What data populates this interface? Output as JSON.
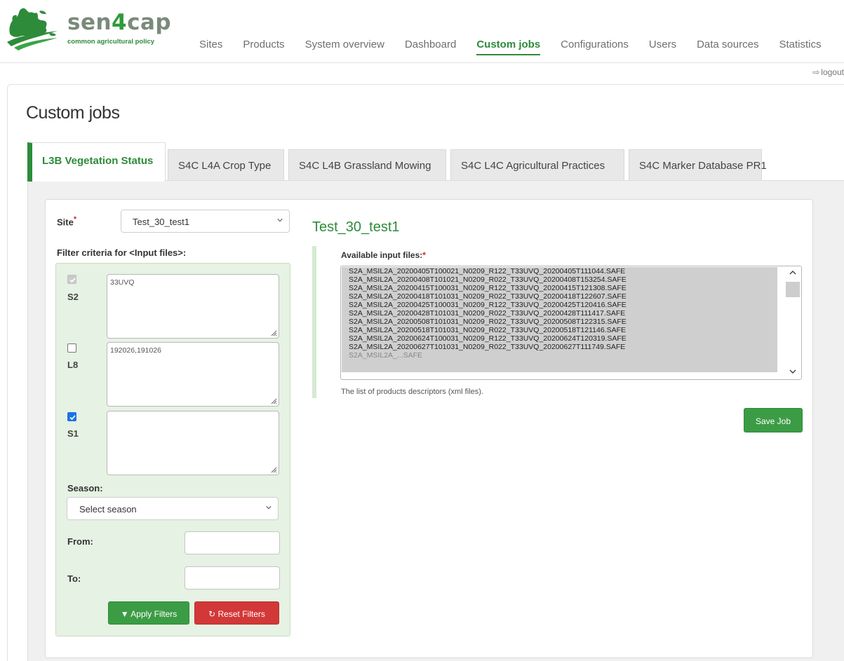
{
  "brand": {
    "name_part1": "sen",
    "name_part2": "4",
    "name_part3": "cap",
    "tagline": "common agricultural policy"
  },
  "nav": {
    "items": [
      {
        "label": "Sites",
        "active": false
      },
      {
        "label": "Products",
        "active": false
      },
      {
        "label": "System overview",
        "active": false
      },
      {
        "label": "Dashboard",
        "active": false
      },
      {
        "label": "Custom jobs",
        "active": true
      },
      {
        "label": "Configurations",
        "active": false
      },
      {
        "label": "Users",
        "active": false
      },
      {
        "label": "Data sources",
        "active": false
      },
      {
        "label": "Statistics",
        "active": false
      }
    ]
  },
  "logout": {
    "label": "logout",
    "icon": "sign-out-icon"
  },
  "page": {
    "title": "Custom jobs"
  },
  "tabs": [
    {
      "label": "L3B Vegetation Status",
      "active": true
    },
    {
      "label": "S4C L4A Crop Type",
      "active": false
    },
    {
      "label": "S4C L4B Grassland Mowing",
      "active": false
    },
    {
      "label": "S4C L4C Agricultural Practices",
      "active": false
    },
    {
      "label": "S4C Marker Database PR1",
      "active": false
    }
  ],
  "form": {
    "site_label": "Site",
    "site_required_mark": "*",
    "site_value": "Test_30_test1",
    "filter_label": "Filter criteria for <Input files>:",
    "sensors": [
      {
        "label": "S2",
        "checked": true,
        "disabled": true,
        "tiles": "33UVQ"
      },
      {
        "label": "L8",
        "checked": false,
        "disabled": false,
        "tiles": "192026,191026"
      },
      {
        "label": "S1",
        "checked": true,
        "disabled": false,
        "tiles": ""
      }
    ],
    "season_label": "Season:",
    "season_value": "Select season",
    "from_label": "From:",
    "from_value": "",
    "to_label": "To:",
    "to_value": "",
    "apply_label": "Apply Filters",
    "reset_label": "Reset Filters"
  },
  "right": {
    "site_heading": "Test_30_test1",
    "files_label": "Available input files:",
    "files_required_mark": "*",
    "files": [
      "S2A_MSIL2A_20200405T100021_N0209_R122_T33UVQ_20200405T111044.SAFE",
      "S2A_MSIL2A_20200408T101021_N0209_R022_T33UVQ_20200408T153254.SAFE",
      "S2A_MSIL2A_20200415T100031_N0209_R122_T33UVQ_20200415T121308.SAFE",
      "S2A_MSIL2A_20200418T101031_N0209_R022_T33UVQ_20200418T122607.SAFE",
      "S2A_MSIL2A_20200425T100031_N0209_R122_T33UVQ_20200425T120416.SAFE",
      "S2A_MSIL2A_20200428T101031_N0209_R022_T33UVQ_20200428T111417.SAFE",
      "S2A_MSIL2A_20200508T101031_N0209_R022_T33UVQ_20200508T122315.SAFE",
      "S2A_MSIL2A_20200518T101031_N0209_R022_T33UVQ_20200518T121146.SAFE",
      "S2A_MSIL2A_20200624T100031_N0209_R122_T33UVQ_20200624T120319.SAFE",
      "S2A_MSIL2A_20200627T101031_N0209_R022_T33UVQ_20200627T111749.SAFE"
    ],
    "files_help": "The list of products descriptors (xml files).",
    "save_label": "Save Job"
  },
  "colors": {
    "brand_green": "#2e8b3a",
    "apply_green": "#3c9c45",
    "reset_red": "#d23838",
    "filter_bg": "#e6f2e3",
    "checkbox_blue": "#1a73e8"
  }
}
